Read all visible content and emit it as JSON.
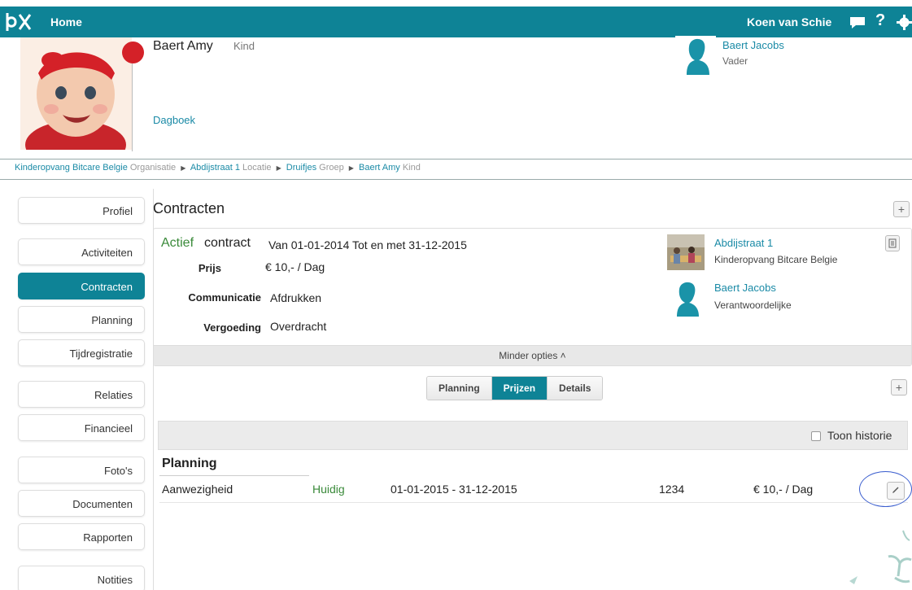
{
  "topbar": {
    "home": "Home",
    "user": "Koen van Schie",
    "help": "?"
  },
  "profile": {
    "name": "Baert Amy",
    "role": "Kind",
    "diary": "Dagboek",
    "parent": {
      "name": "Baert Jacobs",
      "role": "Vader"
    }
  },
  "breadcrumb": {
    "org": "Kinderopvang Bitcare Belgie",
    "org_label": "Organisatie",
    "location": "Abdijstraat 1",
    "location_label": "Locatie",
    "group": "Druifjes",
    "group_label": "Groep",
    "child": "Baert Amy",
    "child_label": "Kind"
  },
  "sidebar": {
    "items": [
      {
        "label": "Profiel"
      },
      {
        "label": "Activiteiten"
      },
      {
        "label": "Contracten"
      },
      {
        "label": "Planning"
      },
      {
        "label": "Tijdregistratie"
      },
      {
        "label": "Relaties"
      },
      {
        "label": "Financieel"
      },
      {
        "label": "Foto's"
      },
      {
        "label": "Documenten"
      },
      {
        "label": "Rapporten"
      },
      {
        "label": "Notities"
      }
    ],
    "active": "Contracten"
  },
  "main": {
    "title": "Contracten",
    "add": "+",
    "contract": {
      "status": "Actief",
      "word": "contract",
      "period": "Van 01-01-2014 Tot en met 31-12-2015",
      "price_label": "Prijs",
      "price_value": "€ 10,- / Dag",
      "comm_label": "Communicatie",
      "comm_value": "Afdrukken",
      "comp_label": "Vergoeding",
      "comp_value": "Overdracht",
      "location_name": "Abdijstraat 1",
      "location_org": "Kinderopvang Bitcare Belgie",
      "responsible_name": "Baert Jacobs",
      "responsible_role": "Verantwoordelijke",
      "less_options": "Minder opties  ˄"
    },
    "tabs": [
      {
        "label": "Planning"
      },
      {
        "label": "Prijzen"
      },
      {
        "label": "Details"
      }
    ],
    "active_tab": "Prijzen",
    "history_label": "Toon historie",
    "section_title": "Planning",
    "row": {
      "type": "Aanwezigheid",
      "status": "Huidig",
      "period": "01-01-2015 - 31-12-2015",
      "code": "1234",
      "price": "€ 10,-  / Dag"
    }
  }
}
